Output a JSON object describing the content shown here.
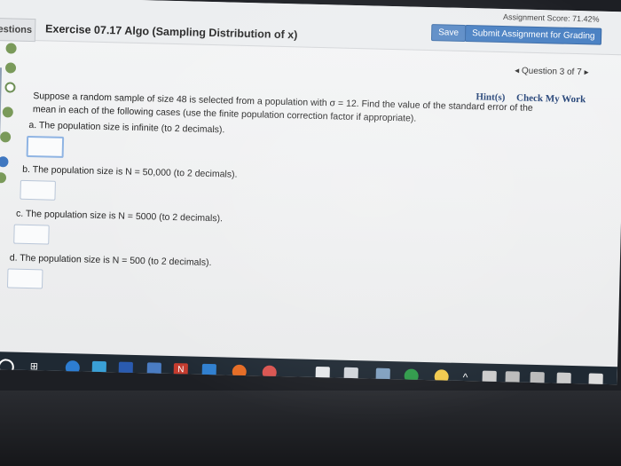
{
  "header": {
    "score": "Assignment Score: 71.42%",
    "save_label": "Save",
    "submit_label": "Submit Assignment for Grading",
    "questions_tab": "estions",
    "exercise_title": "Exercise 07.17 Algo (Sampling Distribution of x)"
  },
  "navigation": {
    "question_nav": "◂ Question 3 of 7 ▸",
    "hints_label": "Hint(s)",
    "check_label": "Check My Work"
  },
  "question": {
    "intro_line1": "Suppose a random sample of size 48 is selected from a population with σ = 12. Find the value of the standard error of the",
    "intro_line2": "mean in each of the following cases (use the finite population correction factor if appropriate).",
    "parts": [
      {
        "label": "a. The population size is infinite (to 2 decimals).",
        "answer": ""
      },
      {
        "label": "b. The population size is N = 50,000 (to 2 decimals).",
        "answer": ""
      },
      {
        "label": "c. The population size is N = 5000 (to 2 decimals).",
        "answer": ""
      },
      {
        "label": "d. The population size is N = 500 (to 2 decimals).",
        "answer": ""
      }
    ]
  },
  "taskbar": {
    "start_icon": "windows-start-icon",
    "task_view_icon": "task-view-icon",
    "apps": [
      "edge-icon",
      "store-icon",
      "word-icon",
      "photos-icon",
      "netflix-icon",
      "cube-icon",
      "firefox-icon",
      "red-circle-icon",
      "document-icon",
      "mail-icon",
      "network-icon",
      "chrome-icon",
      "yellow-circle-icon"
    ],
    "tray": [
      "up-arrow-icon",
      "battery-icon",
      "wifi-icon",
      "volume-icon",
      "keyboard-icon",
      "notification-icon"
    ]
  },
  "colors": {
    "accent": "#4a81c3",
    "link": "#1f3f74",
    "progress_dot": "#7a9a5a"
  }
}
